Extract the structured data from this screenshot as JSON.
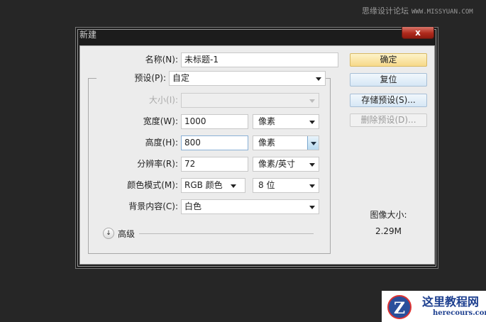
{
  "watermark": {
    "cn": "思缘设计论坛",
    "url": "WWW.MISSYUAN.COM"
  },
  "dialog": {
    "title": "新建",
    "close": "x",
    "name": {
      "label": "名称(N):",
      "value": "未标题-1"
    },
    "preset": {
      "label": "预设(P):",
      "value": "自定"
    },
    "size": {
      "label": "大小(I):",
      "value": ""
    },
    "width": {
      "label": "宽度(W):",
      "value": "1000",
      "unit": "像素"
    },
    "height": {
      "label": "高度(H):",
      "value": "800",
      "unit": "像素"
    },
    "resolution": {
      "label": "分辨率(R):",
      "value": "72",
      "unit": "像素/英寸"
    },
    "color_mode": {
      "label": "颜色模式(M):",
      "value": "RGB 颜色",
      "bits": "8 位"
    },
    "background": {
      "label": "背景内容(C):",
      "value": "白色"
    },
    "advanced": "高级",
    "buttons": {
      "ok": "确定",
      "reset": "复位",
      "save_preset": "存储预设(S)...",
      "delete_preset": "删除预设(D)..."
    },
    "image_size_label": "图像大小:",
    "image_size": "2.29M"
  },
  "logo": {
    "cn": "这里教程网",
    "url": "herecours.com"
  }
}
